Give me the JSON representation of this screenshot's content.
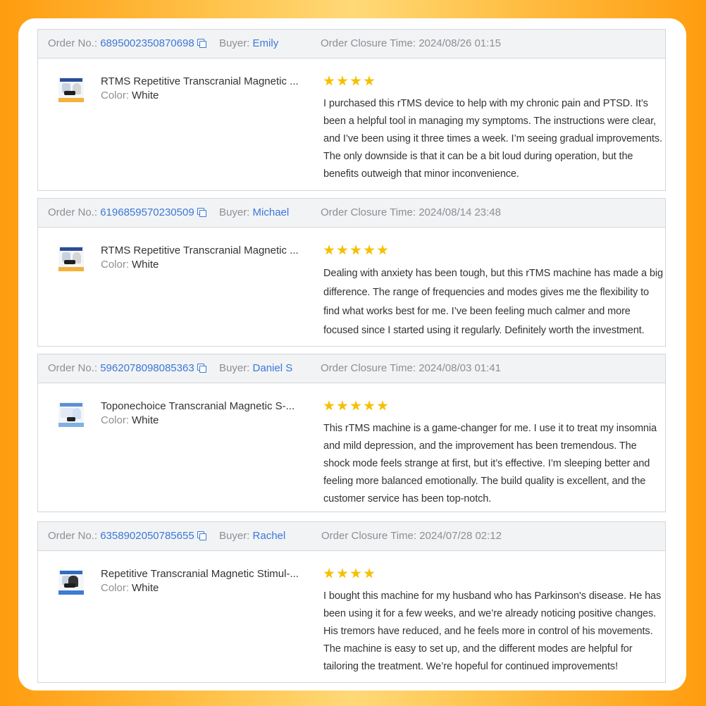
{
  "labels": {
    "order_no": "Order No.:",
    "buyer": "Buyer:",
    "closure": "Order Closure Time:",
    "color": "Color:"
  },
  "colors": {
    "accent_blue": "#3a78d8",
    "star_yellow": "#f5c000",
    "background_orange": "#ff9c0f"
  },
  "icons": {
    "copy": "copy-icon",
    "star": "star-icon"
  },
  "orders": [
    {
      "order_no": "6895002350870698",
      "buyer": "Emily",
      "closure_time": "2024/08/26 01:15",
      "product_title": "RTMS Repetitive Transcranial Magnetic ...",
      "color": "White",
      "rating": 4,
      "review": "I purchased this rTMS device to help with my chronic pain and PTSD. It’s been a helpful tool in managing my symptoms. The instructions were clear, and I’ve been using it three times a week. I’m seeing gradual improvements. The only downside is that it can be a bit loud during operation, but the benefits outweigh that minor inconvenience."
    },
    {
      "order_no": "6196859570230509",
      "buyer": "Michael",
      "closure_time": "2024/08/14 23:48",
      "product_title": "RTMS Repetitive Transcranial Magnetic ...",
      "color": "White",
      "rating": 5,
      "review": "Dealing with anxiety has been tough, but this rTMS machine has made a big difference. The range of frequencies and modes gives me the flexibility to find what works best for me. I’ve been feeling much calmer and more focused since I started using it regularly. Definitely worth the investment."
    },
    {
      "order_no": "5962078098085363",
      "buyer": "Daniel S",
      "closure_time": "2024/08/03 01:41",
      "product_title": "Toponechoice Transcranial Magnetic S-...",
      "color": "White",
      "rating": 5,
      "review": "This rTMS machine is a game-changer for me. I use it to treat my insomnia and mild depression, and the improvement has been tremendous. The shock mode feels strange at first, but it’s effective. I’m sleeping better and feeling more balanced emotionally. The build quality is excellent, and the customer service has been top-notch."
    },
    {
      "order_no": "6358902050785655",
      "buyer": "Rachel",
      "closure_time": "2024/07/28 02:12",
      "product_title": "Repetitive Transcranial Magnetic Stimul-...",
      "color": "White",
      "rating": 4,
      "review": "I bought this machine for my husband who has Parkinson's disease. He has been using it for a few weeks, and we’re already noticing positive changes. His tremors have reduced, and he feels more in control of his movements. The machine is easy to set up, and the different modes are helpful for tailoring the treatment. We’re hopeful for continued improvements!"
    }
  ]
}
